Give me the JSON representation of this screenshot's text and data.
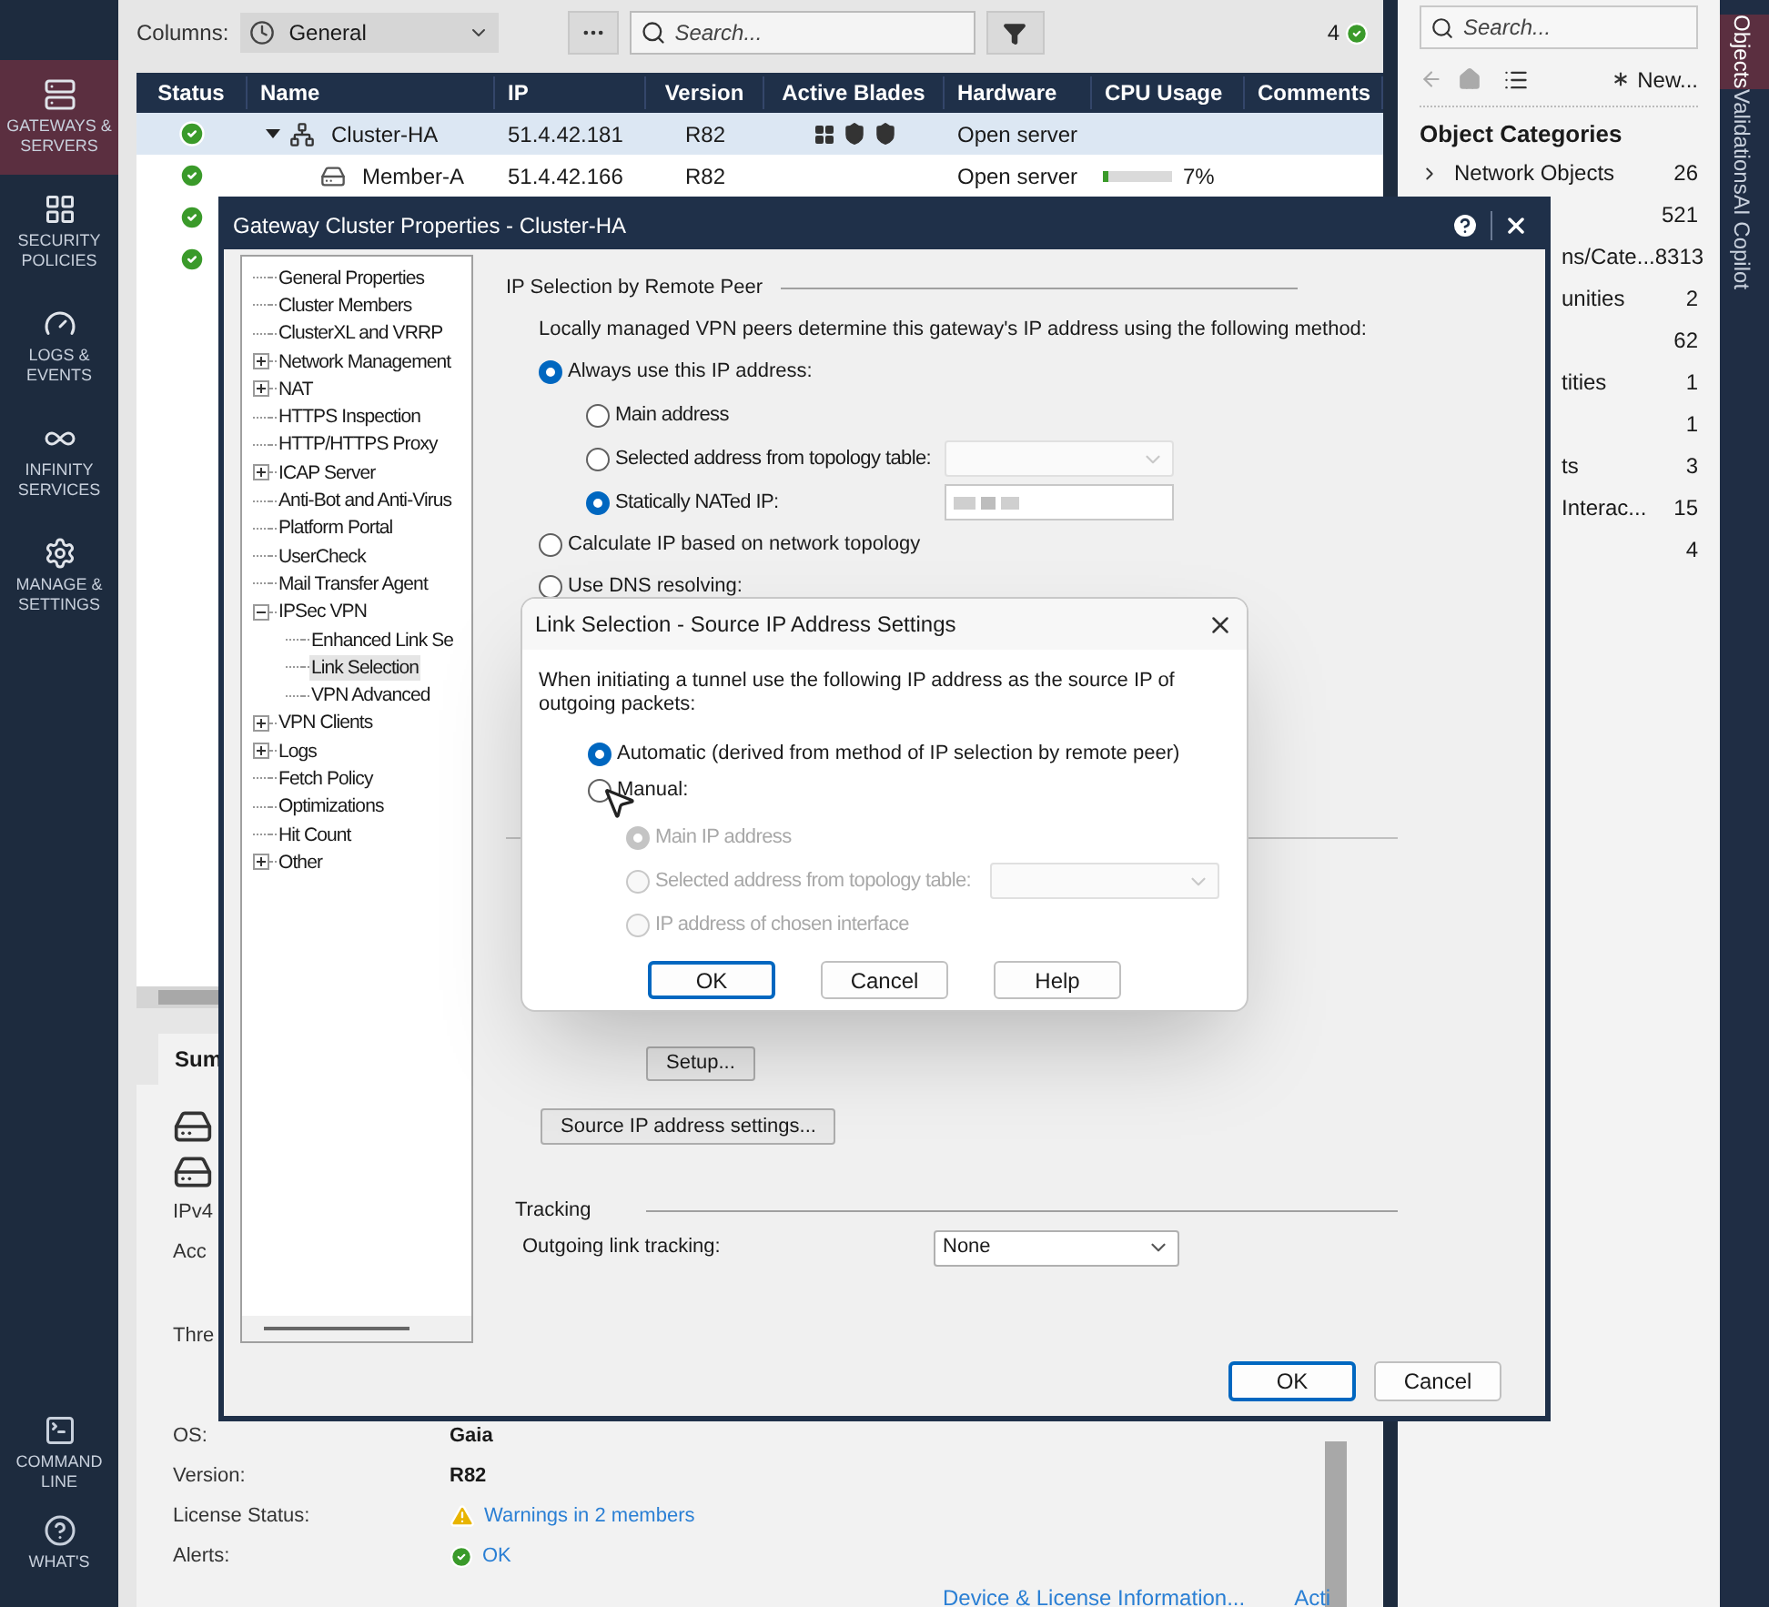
{
  "nav": {
    "items": [
      {
        "label": "GATEWAYS & SERVERS",
        "selected": true
      },
      {
        "label": "SECURITY POLICIES",
        "selected": false
      },
      {
        "label": "LOGS & EVENTS",
        "selected": false
      },
      {
        "label": "INFINITY SERVICES",
        "selected": false
      },
      {
        "label": "MANAGE & SETTINGS",
        "selected": false
      }
    ],
    "bottom": [
      {
        "label": "COMMAND LINE"
      },
      {
        "label": "WHAT'S"
      }
    ]
  },
  "toolbar": {
    "columns_label": "Columns:",
    "columns_value": "General",
    "search_placeholder": "Search...",
    "count": "4"
  },
  "table": {
    "columns": [
      "Status",
      "Name",
      "IP",
      "Version",
      "Active Blades",
      "Hardware",
      "CPU Usage",
      "Comments"
    ],
    "rows": [
      {
        "healthy": true,
        "kind": "cluster",
        "name": "Cluster-HA",
        "ip": "51.4.42.181",
        "version": "R82",
        "hardware": "Open server",
        "selected": true,
        "expanded": true
      },
      {
        "healthy": true,
        "kind": "member",
        "name": "Member-A",
        "ip": "51.4.42.166",
        "version": "R82",
        "hardware": "Open server",
        "cpu": {
          "level": 0.07,
          "reading": "7%"
        },
        "selected": false
      },
      {
        "healthy": true,
        "selected": false
      },
      {
        "healthy": true,
        "selected": false
      }
    ]
  },
  "summary": {
    "tab": "Sum",
    "fields": [
      {
        "label": "IPv4"
      },
      {
        "label": "Acc"
      },
      {
        "label": "Thre"
      },
      {
        "label": "OS:",
        "value": "Gaia"
      },
      {
        "label": "Version:",
        "value": "R82",
        "kind": "bold"
      },
      {
        "label": "License Status:",
        "value": "Warnings in 2 members",
        "kind": "warning"
      },
      {
        "label": "Alerts:",
        "value": "OK",
        "kind": "ok"
      }
    ],
    "links": [
      "Device & License Information...",
      "Acti"
    ]
  },
  "right_panel": {
    "search_placeholder": "Search...",
    "new_label": "New...",
    "title": "Object Categories",
    "categories": [
      {
        "label": "Network Objects",
        "count": "26"
      },
      {
        "count": "521"
      },
      {
        "label": "ns/Cate...",
        "count": "8313"
      },
      {
        "label": "unities",
        "count": "2"
      },
      {
        "count": "62"
      },
      {
        "label": "tities",
        "count": "1"
      },
      {
        "count": "1"
      },
      {
        "label": "ts",
        "count": "3"
      },
      {
        "label": "Interac...",
        "count": "15"
      },
      {
        "count": "4"
      }
    ]
  },
  "side_tabs": [
    {
      "label": "Objects",
      "selected": true
    },
    {
      "label": "Validations",
      "selected": false
    },
    {
      "label": "AI Copilot",
      "selected": false
    }
  ],
  "dialog": {
    "title": "Gateway Cluster Properties - Cluster-HA",
    "tree": [
      {
        "label": "General Properties",
        "selected": false
      },
      {
        "label": "Cluster Members",
        "selected": false
      },
      {
        "label": "ClusterXL and VRRP",
        "selected": false
      },
      {
        "label": "Network Management",
        "selected": false,
        "expandable": true,
        "expanded": false
      },
      {
        "label": "NAT",
        "selected": false,
        "expandable": true,
        "expanded": false
      },
      {
        "label": "HTTPS Inspection",
        "selected": false
      },
      {
        "label": "HTTP/HTTPS Proxy",
        "selected": false
      },
      {
        "label": "ICAP Server",
        "selected": false,
        "expandable": true,
        "expanded": false
      },
      {
        "label": "Anti-Bot and Anti-Virus",
        "selected": false
      },
      {
        "label": "Platform Portal",
        "selected": false
      },
      {
        "label": "UserCheck",
        "selected": false
      },
      {
        "label": "Mail Transfer Agent",
        "selected": false
      },
      {
        "label": "IPSec VPN",
        "selected": false,
        "expandable": true,
        "expanded": true,
        "children": [
          {
            "label": "Enhanced Link Se",
            "selected": false
          },
          {
            "label": "Link Selection",
            "selected": true
          },
          {
            "label": "VPN Advanced",
            "selected": false
          }
        ]
      },
      {
        "label": "VPN Clients",
        "selected": false,
        "expandable": true,
        "expanded": false
      },
      {
        "label": "Logs",
        "selected": false,
        "expandable": true,
        "expanded": false
      },
      {
        "label": "Fetch Policy",
        "selected": false
      },
      {
        "label": "Optimizations",
        "selected": false
      },
      {
        "label": "Hit Count",
        "selected": false
      },
      {
        "label": "Other",
        "selected": false,
        "expandable": true,
        "expanded": false
      }
    ],
    "section_title": "IP Selection by Remote Peer",
    "description": "Locally managed VPN peers determine this gateway's IP address using the following method:",
    "options": [
      {
        "label": "Always use this IP address:",
        "selected": true,
        "children": [
          {
            "label": "Main address",
            "selected": false
          },
          {
            "label": "Selected address from topology table:",
            "selected": false,
            "kind": "select"
          },
          {
            "label": "Statically NATed IP:",
            "selected": true,
            "kind": "masked"
          }
        ]
      },
      {
        "label": "Calculate IP based on network topology",
        "selected": false
      },
      {
        "label": "Use DNS resolving:",
        "selected": false
      }
    ],
    "setup_button": "Setup...",
    "source_button": "Source IP address settings...",
    "tracking": {
      "title": "Tracking",
      "label": "Outgoing link tracking:",
      "value": "None"
    },
    "buttons": [
      {
        "label": "OK",
        "default": true
      },
      {
        "label": "Cancel",
        "default": false
      }
    ]
  },
  "link_dialog": {
    "title": "Link Selection - Source IP Address Settings",
    "description": "When initiating a tunnel use the following IP address as the source IP of outgoing packets:",
    "options": [
      {
        "label": "Automatic (derived from method of IP selection by remote peer)",
        "selected": true
      },
      {
        "label": "Manual:",
        "selected": false,
        "children": [
          {
            "label": "Main IP address",
            "selected": true,
            "disabled": true
          },
          {
            "label": "Selected address from topology table:",
            "selected": false,
            "disabled": true,
            "kind": "select"
          },
          {
            "label": "IP address of chosen interface",
            "selected": false,
            "disabled": true
          }
        ]
      }
    ],
    "buttons": [
      {
        "label": "OK",
        "default": true
      },
      {
        "label": "Cancel",
        "default": false
      },
      {
        "label": "Help",
        "default": false
      }
    ]
  }
}
